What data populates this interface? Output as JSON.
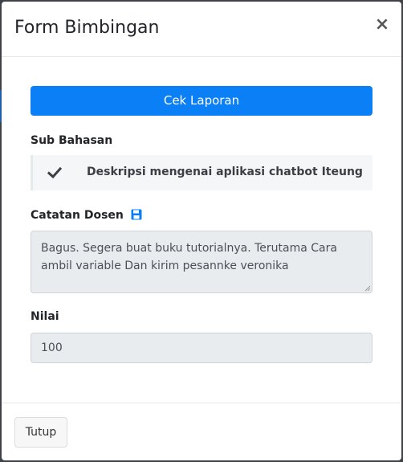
{
  "modal": {
    "title": "Form Bimbingan",
    "close_label": "×"
  },
  "actions": {
    "check_report_label": "Cek Laporan"
  },
  "sub_bahasan": {
    "label": "Sub Bahasan",
    "items": [
      {
        "icon": "check-icon",
        "text": "Deskripsi mengenai aplikasi chatbot Iteung"
      }
    ]
  },
  "catatan": {
    "label": "Catatan Dosen",
    "icon": "save-icon",
    "value": "Bagus. Segera buat buku tutorialnya. Terutama Cara ambil variable Dan kirim pesannke veronika"
  },
  "nilai": {
    "label": "Nilai",
    "value": "100"
  },
  "footer": {
    "close_button_label": "Tutup"
  },
  "colors": {
    "primary": "#0b7ff6",
    "readonly_bg": "#e9ecef",
    "list_bg": "#f4f6f8"
  }
}
